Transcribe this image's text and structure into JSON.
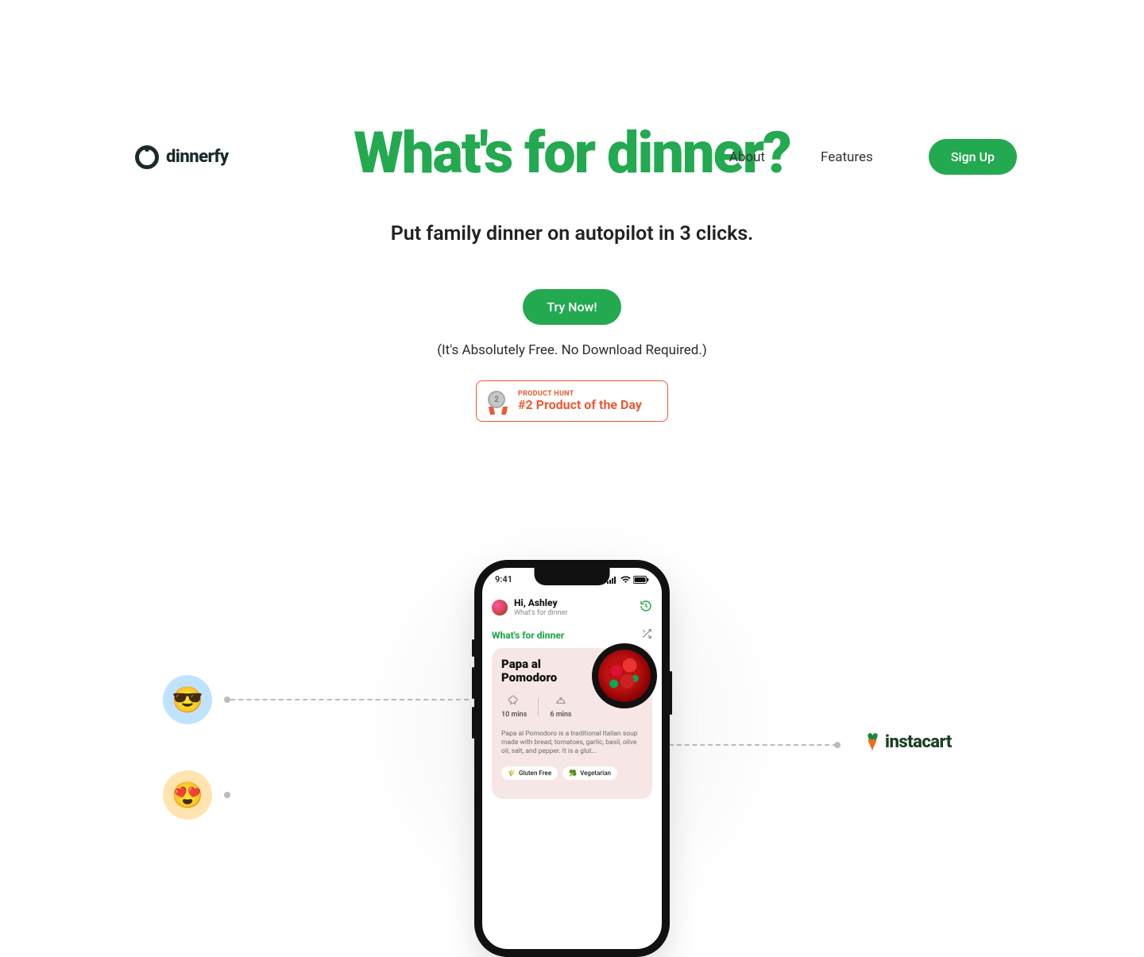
{
  "brand": {
    "name": "dinnerfy"
  },
  "nav": {
    "about": "About",
    "features": "Features",
    "signup": "Sign Up"
  },
  "hero": {
    "headline": "What's for dinner?",
    "subhead": "Put family dinner on autopilot in 3 clicks.",
    "cta": "Try Now!",
    "note": "(It's Absolutely Free. No Download Required.)"
  },
  "producthunt": {
    "rank_num": "2",
    "label": "PRODUCT HUNT",
    "title": "#2 Product of the Day"
  },
  "phone": {
    "clock": "9:41",
    "greet_name": "Hi, Ashley",
    "greet_sub": "What's for dinner",
    "section": "What's for dinner",
    "dish": "Papa al Pomodoro",
    "prep_time": "10 mins",
    "cook_time": "6 mins",
    "desc": "Papa al Pomodoro is a traditional Italian soup made with bread, tomatoes, garlic, basil, olive oil, salt, and pepper. It is a glut...",
    "tag1": "Gluten Free",
    "tag2": "Vegetarian"
  },
  "partners": {
    "instacart": "instacart"
  },
  "emoji": {
    "avatar1": "😎",
    "avatar2": "😍",
    "wheat": "🌾",
    "broccoli": "🥦"
  }
}
